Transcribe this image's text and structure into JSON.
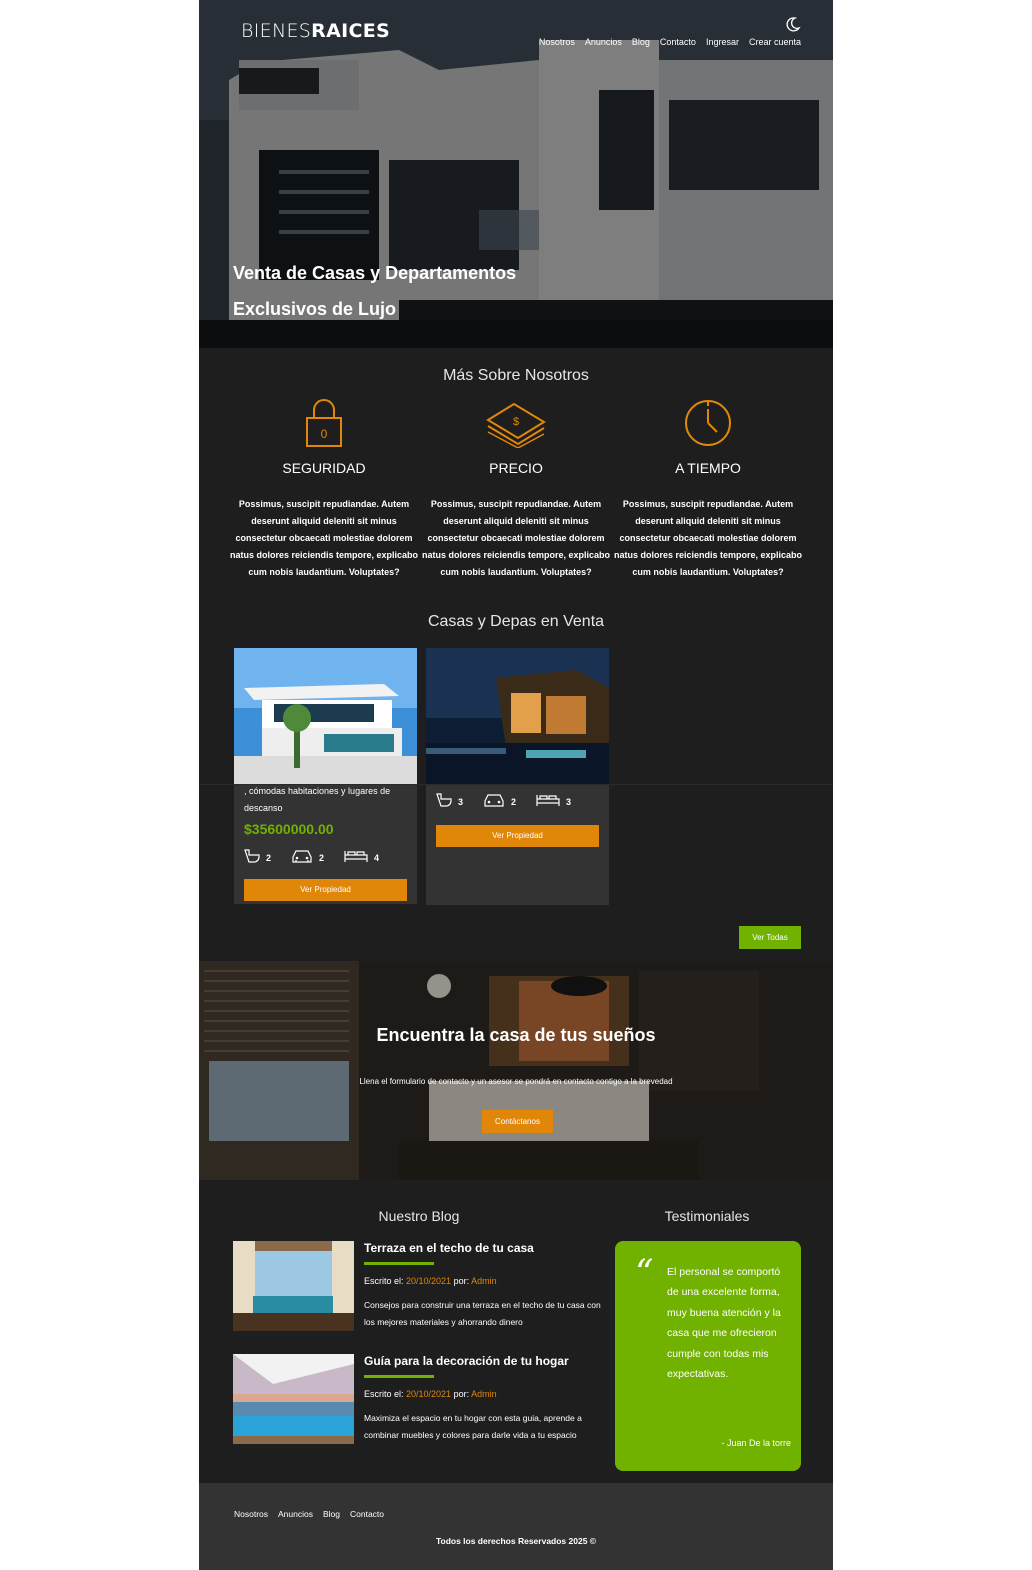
{
  "header": {
    "logo_light": "BIENES",
    "logo_bold": "RAICES",
    "nav": [
      "Nosotros",
      "Anuncios",
      "Blog",
      "Contacto",
      "Ingresar",
      "Crear cuenta"
    ],
    "hero_title": "Venta de Casas y Departamentos Exclusivos de Lujo"
  },
  "about": {
    "title": "Más Sobre Nosotros",
    "features": [
      {
        "icon": "lock-icon",
        "title": "SEGURIDAD",
        "text": "Possimus, suscipit repudiandae. Autem deserunt aliquid deleniti sit minus consectetur obcaecati molestiae dolorem natus dolores reiciendis tempore, explicabo cum nobis laudantium. Voluptates?"
      },
      {
        "icon": "money-stack-icon",
        "title": "PRECIO",
        "text": "Possimus, suscipit repudiandae. Autem deserunt aliquid deleniti sit minus consectetur obcaecati molestiae dolorem natus dolores reiciendis tempore, explicabo cum nobis laudantium. Voluptates?"
      },
      {
        "icon": "clock-icon",
        "title": "A TIEMPO",
        "text": "Possimus, suscipit repudiandae. Autem deserunt aliquid deleniti sit minus consectetur obcaecati molestiae dolorem natus dolores reiciendis tempore, explicabo cum nobis laudantium. Voluptates?"
      }
    ]
  },
  "listings": {
    "title": "Casas y Depas en Venta",
    "cards": [
      {
        "desc_line1": ", cómodas habitaciones y lugares de",
        "desc_line2": "descanso",
        "price": "$35600000.00",
        "wc": "2",
        "parking": "2",
        "rooms": "4",
        "button": "Ver Propiedad"
      },
      {
        "wc": "3",
        "parking": "2",
        "rooms": "3",
        "button": "Ver Propiedad"
      }
    ],
    "view_all": "Ver Todas"
  },
  "contact_band": {
    "title": "Encuentra la casa de tus sueños",
    "text": "Llena el formulario de contacto y un asesor se pondrá en contacto contigo a la brevedad",
    "button": "Contáctanos"
  },
  "blog": {
    "title": "Nuestro Blog",
    "posts": [
      {
        "title": "Terraza en el techo de tu casa",
        "meta_prefix": "Escrito el: ",
        "date": "20/10/2021",
        "by": " por: ",
        "author": "Admin",
        "text": "Consejos para construir una terraza en el techo de tu casa con los mejores materiales y ahorrando dinero"
      },
      {
        "title": "Guía para la decoración de tu hogar",
        "meta_prefix": "Escrito el: ",
        "date": "20/10/2021",
        "by": " por: ",
        "author": "Admin",
        "text": "Maximiza el espacio en tu hogar con esta guia, aprende a combinar muebles y colores para darle vida a tu espacio"
      }
    ]
  },
  "testimonials": {
    "title": "Testimoniales",
    "quote_mark": "“",
    "text": "El personal se comportó de una excelente forma, muy buena atención y la casa que me ofrecieron cumple con todas mis expectativas.",
    "author": "- Juan De la torre"
  },
  "footer": {
    "nav": [
      "Nosotros",
      "Anuncios",
      "Blog",
      "Contacto"
    ],
    "copyright": "Todos los derechos Reservados 2025 ©"
  },
  "colors": {
    "accent_orange": "#e08709",
    "accent_green": "#71b100",
    "background": "#1e1e1e",
    "card": "#333333"
  }
}
